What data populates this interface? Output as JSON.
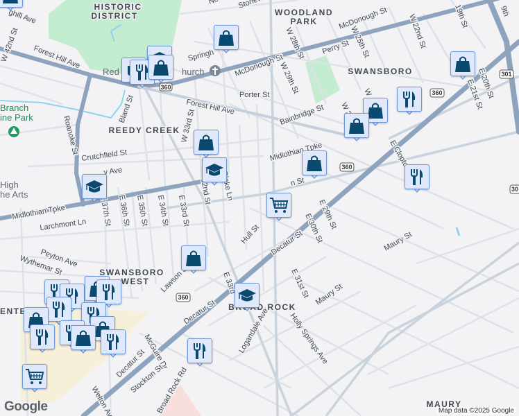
{
  "map": {
    "areas": {
      "historic_1": "HISTORIC",
      "historic_2": "DISTRICT",
      "woodland_1": "WOODLAND",
      "woodland_2": "PARK",
      "swansboro": "SWANSBORO",
      "reedy_creek": "REEDY CREEK",
      "swansboro_west_1": "SWANSBORO",
      "swansboro_west_2": "WEST",
      "broad_rock": "BROAD ROCK",
      "center": "ENTER",
      "maury": "MAURY"
    },
    "pois": {
      "church_left": "Red",
      "church_right": "hurch",
      "park_1": "Branch",
      "park_2": "ine Park",
      "school_1": "High",
      "school_2": "he Arts"
    },
    "streets": [
      "ghill Ave",
      "Forest Hill Ave",
      "W 42nd St",
      "Forest Hill Ave",
      "Bland St",
      "Roanoke St",
      "W 33rd St",
      "Crutchfield St",
      "y Ave",
      "Midlothian Tpke",
      "Larchmont Ln",
      "E 37th St",
      "E 36th St",
      "E 35th St",
      "E 34th St",
      "E 33rd St",
      "32nd St",
      "Blake Ln",
      "Peyton Ave",
      "Wythemar St",
      "Lawson St",
      "Hull St",
      "E 33rd",
      "Decatur St",
      "Decatur St",
      "McGuire Dr",
      "Decatur St",
      "Stockton St",
      "Broad Rock Rd",
      "Welton Ave",
      "Logandale Ave",
      "Holly Springs Ave",
      "Maury St",
      "Maury St",
      "E 31st St",
      "E 30th St",
      "E 29th St",
      "E Clopton",
      "Midlothian Tpke",
      "Bainbridge St",
      "Porter St",
      "McDonough St",
      "Springh",
      "W 28th St",
      "W 29th St",
      "McDonough St",
      "Perry St",
      "W 25th St",
      "W 22nd St",
      "19th St",
      "9th",
      "E 20th St",
      "E 21st St",
      "Stonew",
      "Ne",
      "n St",
      "W 2",
      "W"
    ],
    "shields": [
      "360",
      "360",
      "360",
      "360",
      "301",
      "30"
    ],
    "markers": [
      "shopping-bag",
      "shopping-bag",
      "school-cap",
      "coffee-cup",
      "fork-knife",
      "shopping-bag",
      "shopping-bag",
      "fork-knife",
      "shopping-bag",
      "shopping-bag",
      "shopping-bag",
      "school-cap",
      "shopping-bag",
      "school-cap",
      "fork-knife",
      "grocery-cart",
      "shopping-bag",
      "school-cap",
      "fork-knife",
      "fork-knife",
      "shopping-bag",
      "fork-knife",
      "fork-knife",
      "shopping-bag",
      "fork-knife",
      "fork-knife",
      "shopping-bag",
      "fork-knife",
      "shopping-bag",
      "fork-knife",
      "fork-knife",
      "grocery-cart"
    ],
    "attribution": "Map data ©2025 Google",
    "logo": "Google",
    "colors": {
      "marker_fill": "#dfe9fb",
      "marker_border": "#6e98d8",
      "icon": "#0b4a6f",
      "highway": "#8ea3bd",
      "park": "#c3ecd0"
    }
  }
}
